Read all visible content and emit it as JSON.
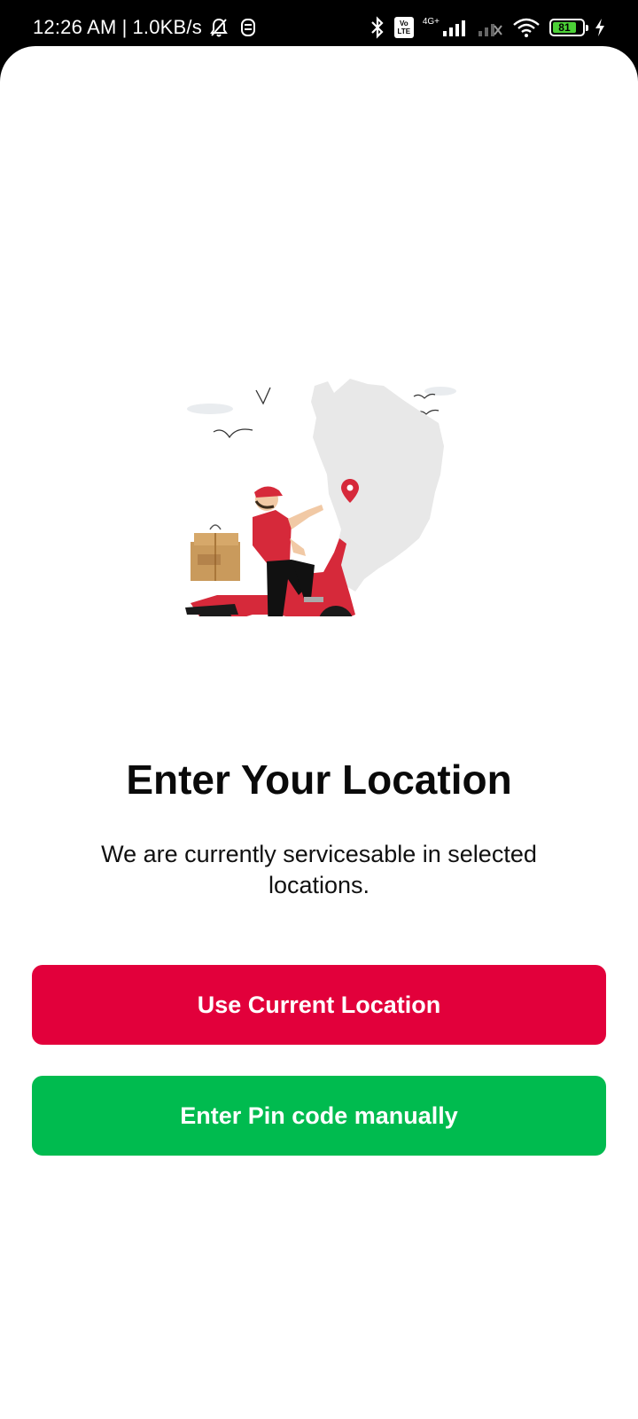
{
  "status_bar": {
    "time": "12:26 AM",
    "separator": "|",
    "network_speed": "1.0KB/s",
    "network_type": "4G+",
    "volte_top": "Vo",
    "volte_bottom": "LTE",
    "battery_level": "81",
    "icons": [
      "mute-bell-icon",
      "vpn-icon",
      "bluetooth-icon",
      "volte-icon",
      "signal-icon",
      "no-signal-icon",
      "wifi-icon",
      "battery-icon",
      "charging-icon"
    ]
  },
  "page": {
    "title": "Enter Your Location",
    "subtitle": "We are currently servicesable in selected locations.",
    "illustration": "delivery-scooter-map-illustration"
  },
  "actions": {
    "use_current_location": "Use Current Location",
    "enter_pin_manually": "Enter Pin code manually"
  },
  "colors": {
    "primary_red": "#e2003b",
    "primary_green": "#00bb4f",
    "status_bar_bg": "#000000",
    "battery_green": "#4cd137"
  }
}
